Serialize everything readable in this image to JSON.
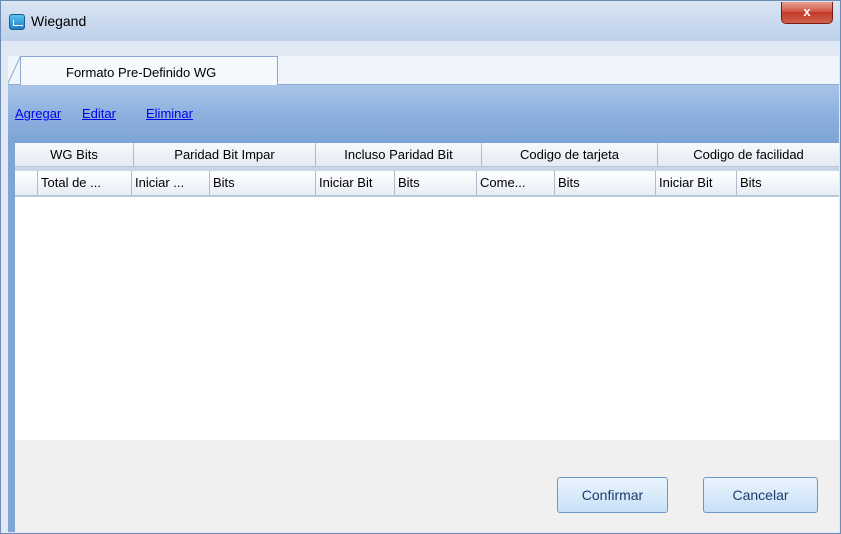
{
  "window": {
    "title": "Wiegand",
    "close_label": "x"
  },
  "tabs": [
    {
      "label": "Formato Pre-Definido WG",
      "selected": true
    }
  ],
  "toolbar": {
    "add_label": "Agregar",
    "edit_label": "Editar",
    "delete_label": "Eliminar"
  },
  "table": {
    "group_headers": [
      "WG Bits",
      "Paridad Bit Impar",
      "Incluso Paridad Bit",
      "Codigo de tarjeta",
      "Codigo de facilidad"
    ],
    "columns": [
      "Total de ...",
      "Iniciar ...",
      "Bits",
      "Iniciar Bit",
      "Bits",
      "Come...",
      "Bits",
      "Iniciar Bit",
      "Bits"
    ],
    "rows": []
  },
  "footer": {
    "confirm_label": "Confirmar",
    "cancel_label": "Cancelar"
  },
  "colors": {
    "accent": "#7fa4d6",
    "link": "#0000ee",
    "close": "#c9473a"
  }
}
